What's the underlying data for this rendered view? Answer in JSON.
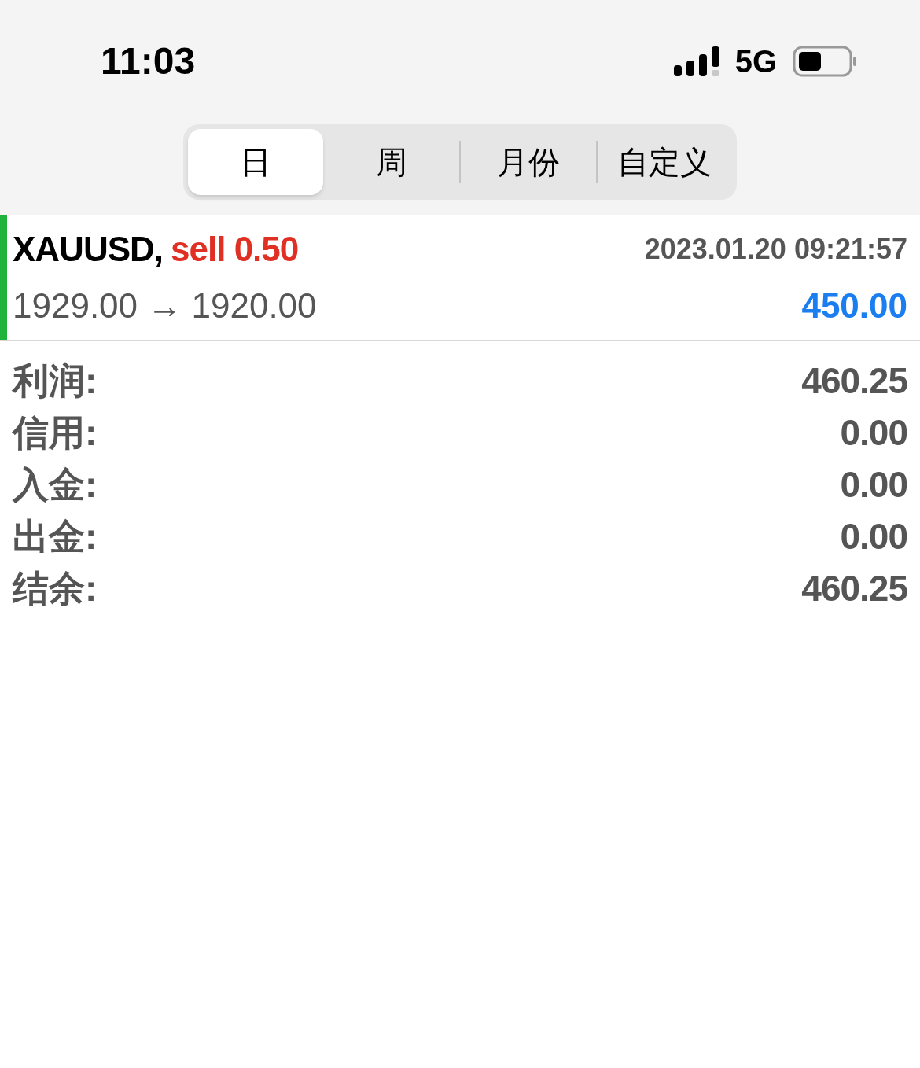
{
  "status_bar": {
    "time": "11:03",
    "network": "5G"
  },
  "tabs": [
    {
      "label": "日",
      "selected": true
    },
    {
      "label": "周",
      "selected": false
    },
    {
      "label": "月份",
      "selected": false
    },
    {
      "label": "自定义",
      "selected": false
    }
  ],
  "trade": {
    "symbol": "XAUUSD,",
    "side": "sell 0.50",
    "time": "2023.01.20 09:21:57",
    "prices": "1929.00 → 1920.00",
    "profit": "450.00"
  },
  "summary": [
    {
      "label": "利润:",
      "value": "460.25"
    },
    {
      "label": "信用:",
      "value": "0.00"
    },
    {
      "label": "入金:",
      "value": "0.00"
    },
    {
      "label": "出金:",
      "value": "0.00"
    },
    {
      "label": "结余:",
      "value": "460.25"
    }
  ]
}
